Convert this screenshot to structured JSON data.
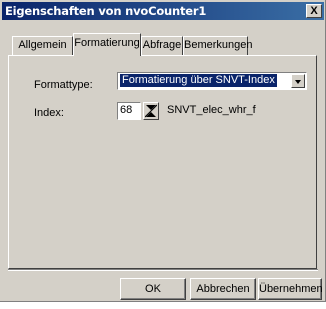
{
  "window": {
    "title": "Eigenschaften von nvoCounter1",
    "close_label": "X"
  },
  "tabs": [
    {
      "label": "Allgemein",
      "active": false
    },
    {
      "label": "Formatierung",
      "active": true
    },
    {
      "label": "Abfrage",
      "active": false
    },
    {
      "label": "Bemerkungen",
      "active": false
    }
  ],
  "form": {
    "formattype_label": "Formattype:",
    "formattype_value": "Formatierung über SNVT-Index",
    "index_label": "Index:",
    "index_value": "68",
    "snvt_name": "SNVT_elec_whr_f"
  },
  "buttons": {
    "ok": "OK",
    "cancel": "Abbrechen",
    "apply": "Übernehmen"
  }
}
